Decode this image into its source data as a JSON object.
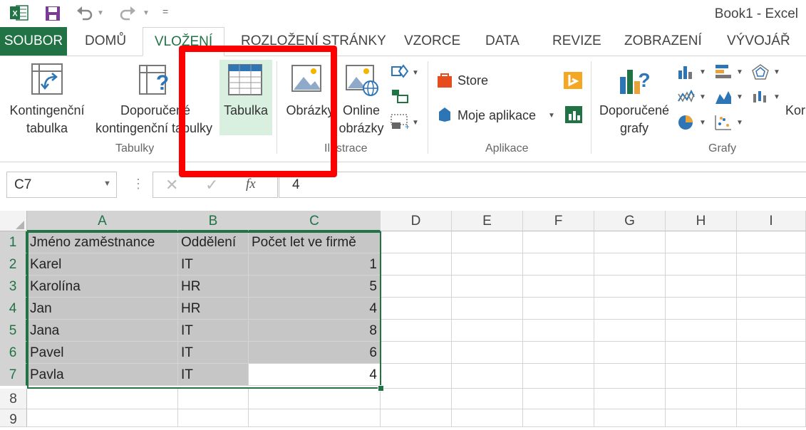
{
  "app": {
    "window_title": "Book1 - Excel"
  },
  "quick_access": {
    "logo": "excel-logo-icon",
    "save": "save-icon",
    "undo": "undo-icon",
    "redo": "redo-icon",
    "more": "="
  },
  "tabs": [
    {
      "label": "SOUBOR"
    },
    {
      "label": "DOMŮ"
    },
    {
      "label": "VLOŽENÍ",
      "active": true
    },
    {
      "label": "ROZLOŽENÍ STRÁNKY"
    },
    {
      "label": "VZORCE"
    },
    {
      "label": "DATA"
    },
    {
      "label": "REVIZE"
    },
    {
      "label": "ZOBRAZENÍ"
    },
    {
      "label": "VÝVOJÁŘ"
    }
  ],
  "ribbon": {
    "groups": {
      "tabulky": "Tabulky",
      "ilustrace": "Ilustrace",
      "aplikace": "Aplikace",
      "grafy": "Grafy"
    },
    "buttons": {
      "kontingencni_1": "Kontingenční",
      "kontingencni_2": "tabulka",
      "doporucene_kont_1": "Doporučené",
      "doporucene_kont_2": "kontingenční tabulky",
      "tabulka": "Tabulka",
      "obrazky": "Obrázky",
      "online_1": "Online",
      "online_2": "obrázky",
      "store": "Store",
      "moje_aplikace": "Moje aplikace",
      "doporucene_grafy_1": "Doporučené",
      "doporucene_grafy_2": "grafy",
      "cut_off": "Kor"
    }
  },
  "formula_bar": {
    "name_box": "C7",
    "cancel": "✕",
    "enter": "✓",
    "fx": "fx",
    "value": "4"
  },
  "sheet": {
    "columns": [
      "A",
      "B",
      "C",
      "D",
      "E",
      "F",
      "G",
      "H",
      "I"
    ],
    "rows": [
      "1",
      "2",
      "3",
      "4",
      "5",
      "6",
      "7",
      "8",
      "9"
    ],
    "cells": [
      [
        "Jméno zaměstnance",
        "Oddělení",
        "Počet let ve firmě"
      ],
      [
        "Karel",
        "IT",
        "1"
      ],
      [
        "Karolína",
        "HR",
        "5"
      ],
      [
        "Jan",
        "HR",
        "4"
      ],
      [
        "Jana",
        "IT",
        "8"
      ],
      [
        "Pavel",
        "IT",
        "6"
      ],
      [
        "Pavla",
        "IT",
        "4"
      ]
    ],
    "active_cell": "C7",
    "selection": "A1:C7"
  },
  "colors": {
    "accent": "#217346",
    "selection_fill": "#c6c6c6",
    "highlight": "#ff0000"
  }
}
